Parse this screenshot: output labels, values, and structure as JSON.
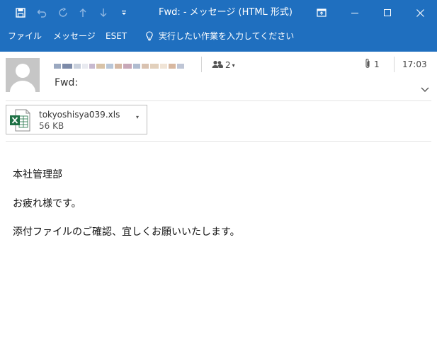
{
  "window": {
    "title": "Fwd:  -  メッセージ (HTML 形式)"
  },
  "quick_access": {
    "save_icon": "save-icon",
    "undo_icon": "undo-icon",
    "redo_icon": "redo-icon",
    "up_icon": "arrow-up-icon",
    "down_icon": "arrow-down-icon",
    "customize_icon": "customize-icon"
  },
  "ribbon": {
    "tabs": [
      "ファイル",
      "メッセージ",
      "ESET"
    ],
    "tell_me": "実行したい作業を入力してください"
  },
  "header": {
    "recipients_count": "2",
    "attachments_count": "1",
    "time": "17:03",
    "subject": "Fwd:"
  },
  "attachment": {
    "name": "tokyoshisya039.xls",
    "size": "56 KB"
  },
  "body": {
    "lines": [
      "本社管理部",
      "お疲れ様です。",
      "添付ファイルのご確認、宜しくお願いいたします。"
    ]
  },
  "colors": {
    "titlebar": "#1f6fbf",
    "excel_green": "#1e7145"
  }
}
